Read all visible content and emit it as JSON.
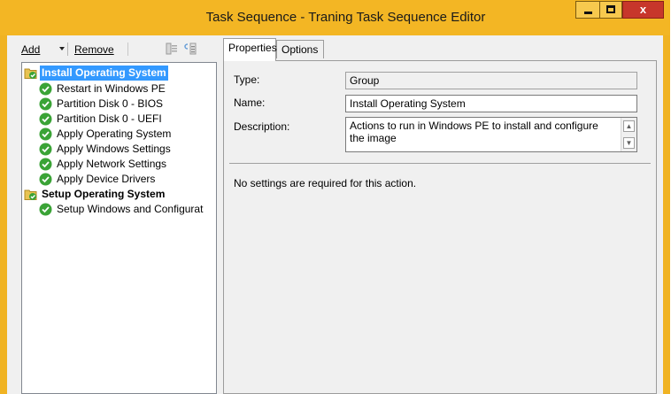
{
  "window": {
    "title": "Task Sequence - Traning Task Sequence Editor",
    "accent_color": "#f3b624",
    "controls": {
      "minimize": "minimize-icon",
      "maximize": "maximize-icon",
      "close": "x"
    }
  },
  "toolbar": {
    "add_label": "Add",
    "remove_label": "Remove",
    "icons": [
      "move-up-icon",
      "move-down-icon"
    ]
  },
  "tree": {
    "groups": [
      {
        "label": "Install Operating System",
        "selected": true,
        "icon": "folder-check-icon",
        "steps": [
          "Restart in Windows PE",
          "Partition Disk 0 - BIOS",
          "Partition Disk 0 - UEFI",
          "Apply Operating System",
          "Apply Windows Settings",
          "Apply Network Settings",
          "Apply Device Drivers"
        ]
      },
      {
        "label": "Setup Operating System",
        "selected": false,
        "icon": "folder-check-icon",
        "steps": [
          "Setup Windows and Configurat"
        ]
      }
    ]
  },
  "tabs": {
    "properties": "Properties",
    "options": "Options"
  },
  "properties": {
    "type_label": "Type:",
    "type_value": "Group",
    "name_label": "Name:",
    "name_value": "Install Operating System",
    "description_label": "Description:",
    "description_value": "Actions to run in Windows PE to install and configure the image",
    "note": "No settings are required  for this action."
  }
}
